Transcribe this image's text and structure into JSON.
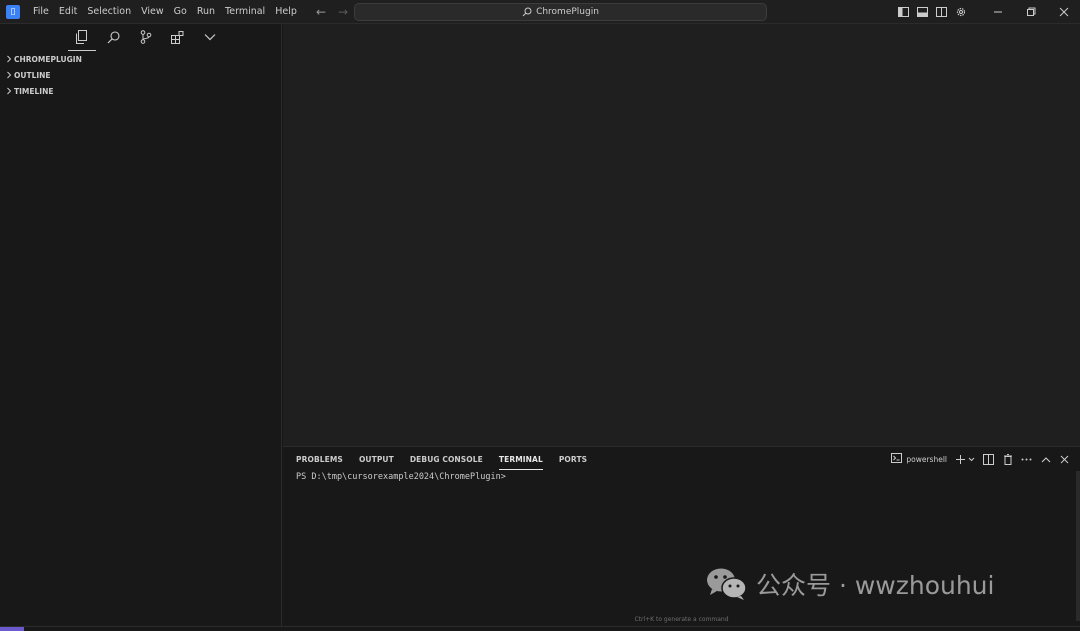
{
  "titlebar": {
    "menu": [
      "File",
      "Edit",
      "Selection",
      "View",
      "Go",
      "Run",
      "Terminal",
      "Help"
    ],
    "nav_back": "←",
    "nav_forward": "→",
    "search_text": "ChromePlugin"
  },
  "sidebar": {
    "sections": [
      {
        "label": "CHROMEPLUGIN"
      },
      {
        "label": "OUTLINE"
      },
      {
        "label": "TIMELINE"
      }
    ]
  },
  "panel": {
    "tabs": [
      {
        "label": "PROBLEMS",
        "active": false
      },
      {
        "label": "OUTPUT",
        "active": false
      },
      {
        "label": "DEBUG CONSOLE",
        "active": false
      },
      {
        "label": "TERMINAL",
        "active": true
      },
      {
        "label": "PORTS",
        "active": false
      }
    ],
    "shell_name": "powershell",
    "terminal_prompt": "PS D:\\tmp\\cursorexample2024\\ChromePlugin>",
    "hint": "Ctrl+K to generate a command"
  },
  "watermark": {
    "text": "公众号 · wwzhouhui"
  },
  "colors": {
    "background": "#181818",
    "editor": "#1f1f1f",
    "accent": "#6a5acd"
  }
}
